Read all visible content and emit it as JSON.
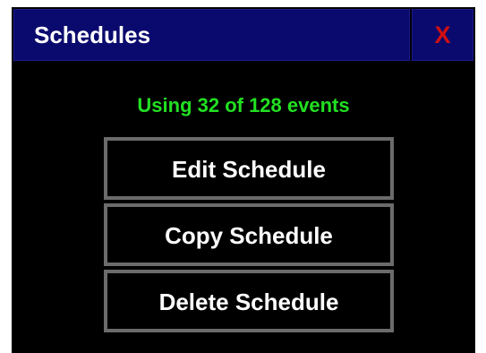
{
  "window": {
    "title": "Schedules",
    "close_label": "X"
  },
  "status": {
    "text": "Using 32 of 128 events"
  },
  "menu": {
    "buttons": [
      {
        "label": "Edit Schedule"
      },
      {
        "label": "Copy Schedule"
      },
      {
        "label": "Delete Schedule"
      }
    ]
  },
  "colors": {
    "title_bar": "#0a0a6e",
    "background": "#000000",
    "close_x": "#d01010",
    "status_text": "#22e022",
    "button_border": "#6b6b6b",
    "button_text": "#ffffff"
  }
}
